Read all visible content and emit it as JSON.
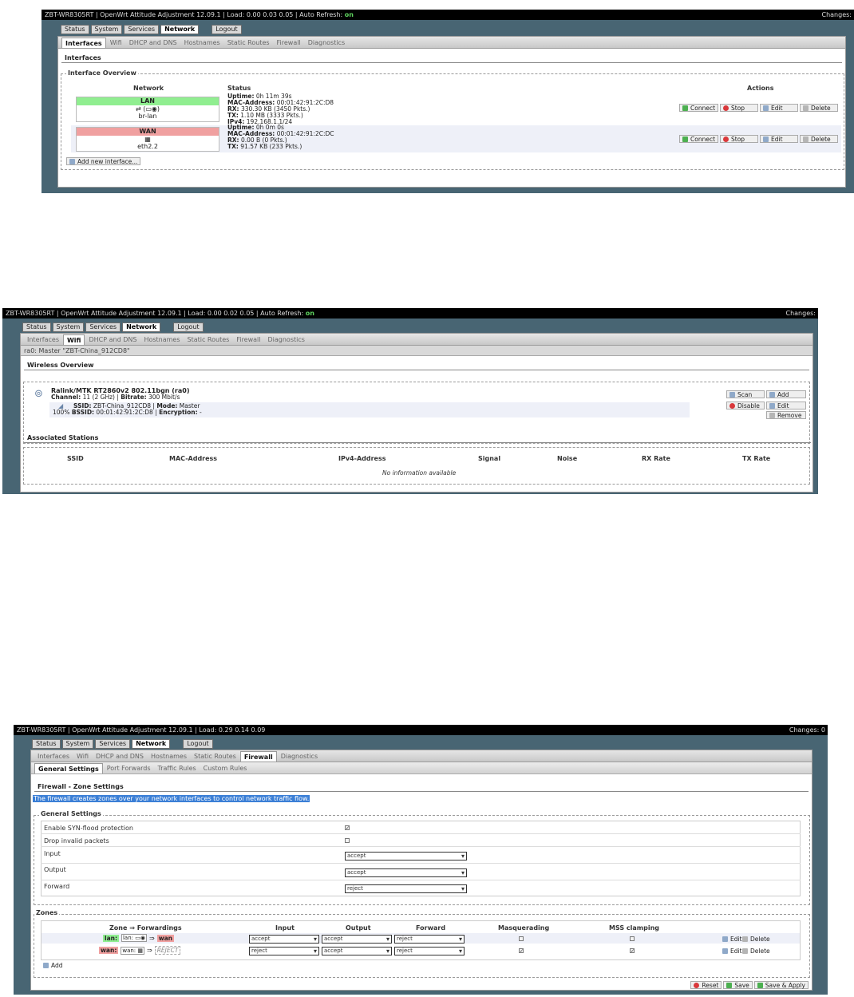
{
  "app": {
    "status_prefix": "ZBT-WR8305RT | OpenWrt Attitude Adjustment 12.09.1 | Load: ",
    "auto_refresh_label": " | Auto Refresh: ",
    "auto_refresh_value": "on",
    "changes_label": "Changes:",
    "changes_full": "Changes: 0"
  },
  "menu": {
    "status": "Status",
    "system": "System",
    "services": "Services",
    "network": "Network",
    "logout": "Logout"
  },
  "tabs": {
    "interfaces": "Interfaces",
    "wifi": "Wifi",
    "dhcp": "DHCP and DNS",
    "hostnames": "Hostnames",
    "static_routes": "Static Routes",
    "firewall": "Firewall",
    "diagnostics": "Diagnostics"
  },
  "screen1": {
    "load": "0.00 0.03 0.05",
    "section_title": "Interfaces",
    "legend": "Interface Overview",
    "col_network": "Network",
    "col_status": "Status",
    "col_actions": "Actions",
    "lan": {
      "name": "LAN",
      "device_line": "(",
      "device": "br-lan",
      "uptime_k": "Uptime:",
      "uptime_v": " 0h 11m 39s",
      "mac_k": "MAC-Address:",
      "mac_v": " 00:01:42:91:2C:D8",
      "rx_k": "RX:",
      "rx_v": " 330.30 KB (3450 Pkts.)",
      "tx_k": "TX:",
      "tx_v": " 1.10 MB (3333 Pkts.)",
      "ipv4_k": "IPv4:",
      "ipv4_v": " 192.168.1.1/24"
    },
    "wan": {
      "name": "WAN",
      "device": "eth2.2",
      "uptime_k": "Uptime:",
      "uptime_v": " 0h 0m 0s",
      "mac_k": "MAC-Address:",
      "mac_v": " 00:01:42:91:2C:DC",
      "rx_k": "RX:",
      "rx_v": " 0.00 B (0 Pkts.)",
      "tx_k": "TX:",
      "tx_v": " 91.57 KB (233 Pkts.)"
    },
    "btn_connect": "Connect",
    "btn_stop": "Stop",
    "btn_edit": "Edit",
    "btn_delete": "Delete",
    "btn_add_iface": "Add new interface..."
  },
  "screen2": {
    "load": "0.00 0.02 0.05",
    "subheader": "ra0: Master \"ZBT-China_912CD8\"",
    "wireless_title": "Wireless Overview",
    "radio_name": "Ralink/MTK RT2860v2 802.11bgn (ra0)",
    "channel_k": "Channel:",
    "channel_v": " 11 (2 GHz) | ",
    "bitrate_k": "Bitrate:",
    "bitrate_v": " 300 Mbit/s",
    "ssid_k": "SSID:",
    "ssid_v": " ZBT-China_912CD8 | ",
    "mode_k": "Mode:",
    "mode_v": " Master",
    "signal_pct": "100%",
    "bssid_k": "BSSID:",
    "bssid_v": " 00:01:42:91:2C:D8 | ",
    "enc_k": "Encryption:",
    "enc_v": " -",
    "btn_scan": "Scan",
    "btn_add": "Add",
    "btn_disable": "Disable",
    "btn_edit": "Edit",
    "btn_remove": "Remove",
    "assoc_title": "Associated Stations",
    "cols": [
      "SSID",
      "MAC-Address",
      "IPv4-Address",
      "Signal",
      "Noise",
      "RX Rate",
      "TX Rate"
    ],
    "no_info": "No information available"
  },
  "screen3": {
    "load": "0.29 0.14 0.09",
    "subtabs": [
      "General Settings",
      "Port Forwards",
      "Traffic Rules",
      "Custom Rules"
    ],
    "title": "Firewall - Zone Settings",
    "desc": "The firewall creates zones over your network interfaces to control network traffic flow.",
    "general_legend": "General Settings",
    "rows": [
      {
        "label": "Enable SYN-flood protection"
      },
      {
        "label": "Drop invalid packets"
      },
      {
        "label": "Input",
        "value": "accept"
      },
      {
        "label": "Output",
        "value": "accept"
      },
      {
        "label": "Forward",
        "value": "reject"
      }
    ],
    "zones_legend": "Zones",
    "zcols": [
      "Zone ⇒ Forwardings",
      "Input",
      "Output",
      "Forward",
      "Masquerading",
      "MSS clamping"
    ],
    "zone_lan": {
      "name": "lan:",
      "iface": "lan:",
      "arrow": "⇒",
      "target": "wan",
      "input": "accept",
      "output": "accept",
      "forward": "reject"
    },
    "zone_wan": {
      "name": "wan:",
      "iface": "wan:",
      "arrow": "⇒",
      "target": "REJECT",
      "input": "reject",
      "output": "accept",
      "forward": "reject"
    },
    "btn_edit": "Edit",
    "btn_delete": "Delete",
    "btn_add": "Add",
    "btn_reset": "Reset",
    "btn_save": "Save",
    "btn_save_apply": "Save & Apply"
  },
  "colors": {
    "lan_green": "#90ee90",
    "wan_red": "#f0a0a0",
    "bg": "#486573"
  }
}
